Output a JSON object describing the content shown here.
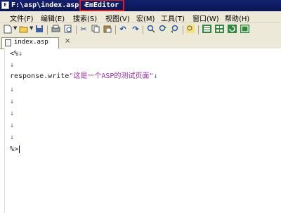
{
  "window": {
    "icon_label": "E",
    "title_path": "F:\\asp\\index.asp -",
    "title_app": "EmEditor"
  },
  "menu": [
    "文件(F)",
    "编辑(E)",
    "搜索(S)",
    "视图(V)",
    "宏(M)",
    "工具(T)",
    "窗口(W)",
    "帮助(H)"
  ],
  "toolbar": {
    "icons": [
      "new",
      "open",
      "save",
      "print",
      "print-preview",
      "cut",
      "copy",
      "paste",
      "undo",
      "redo",
      "find",
      "find-next",
      "find-prev",
      "highlight",
      "view-1",
      "view-2",
      "view-3",
      "view-4"
    ]
  },
  "tab": {
    "label": "index.asp",
    "close": "×"
  },
  "editor": {
    "line1": "<%",
    "line3_code": "response.write",
    "line3_string": "\"这是一个ASP的测试页面\"",
    "last_line": "%>",
    "eol": "↓"
  },
  "colors": {
    "title_bg": "#13206e",
    "highlight": "#e11a1a",
    "string": "#9b2ca0",
    "chrome": "#ece9d8"
  }
}
